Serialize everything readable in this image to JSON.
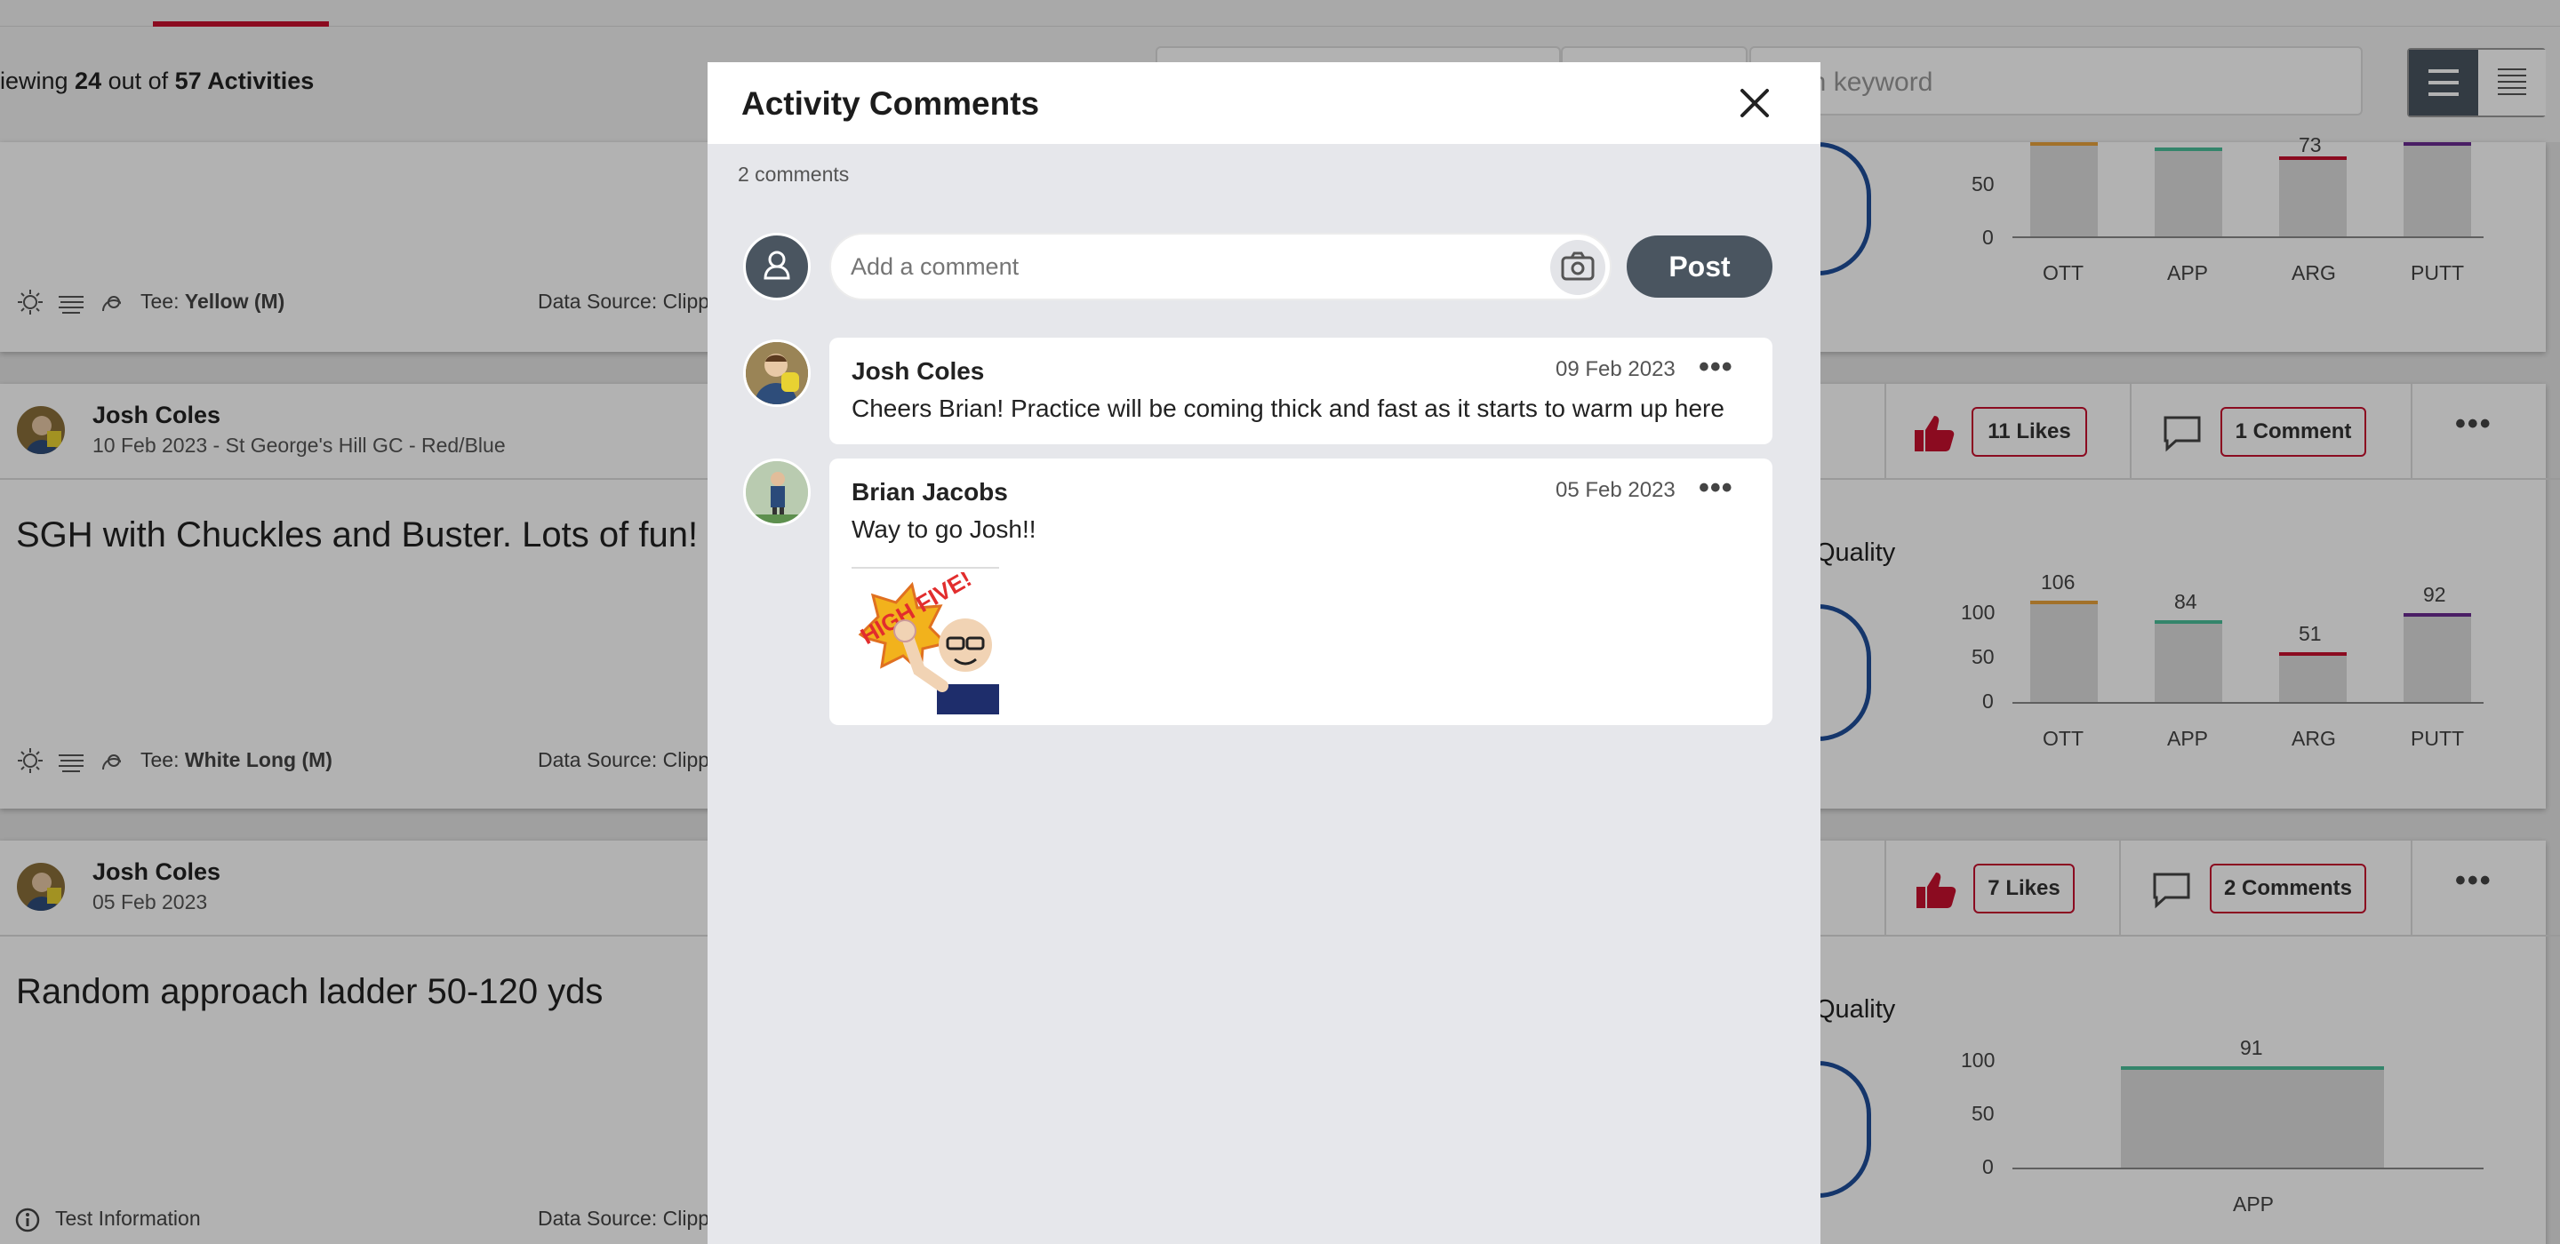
{
  "feed": {
    "viewing_prefix": "iewing ",
    "viewing_count": "24",
    "viewing_mid": " out of ",
    "viewing_total": "57 Activities",
    "search_placeholder": "arch keyword"
  },
  "activities": [
    {
      "tee_label": "Tee: ",
      "tee_value": "Yellow (M)",
      "data_source": "Data Source: Clipp",
      "chart_ticks": [
        "50",
        "0"
      ],
      "chart_labels": [
        "OTT",
        "APP",
        "ARG",
        "PUTT"
      ],
      "value_arg": "73"
    },
    {
      "user": "Josh Coles",
      "subtitle": "10 Feb 2023 - St George's Hill GC - Red/Blue",
      "likes": "11 Likes",
      "comments": "1 Comment",
      "title": "SGH with Chuckles and Buster. Lots of fun!",
      "quality_label": "Quality",
      "tee_label": "Tee: ",
      "tee_value": "White Long (M)",
      "data_source": "Data Source: Clipp",
      "chart_ticks": [
        "100",
        "50",
        "0"
      ],
      "chart_labels": [
        "OTT",
        "APP",
        "ARG",
        "PUTT"
      ],
      "values": [
        "106",
        "84",
        "51",
        "92"
      ]
    },
    {
      "user": "Josh Coles",
      "subtitle": "05 Feb 2023",
      "likes": "7 Likes",
      "comments": "2 Comments",
      "title": "Random approach ladder 50-120 yds",
      "quality_label": "Quality",
      "info": "Test Information",
      "data_source": "Data Source: Clipp",
      "chart_ticks": [
        "100",
        "50",
        "0"
      ],
      "chart_labels": [
        "APP"
      ],
      "values": [
        "91"
      ]
    }
  ],
  "modal": {
    "title": "Activity Comments",
    "count": "2 comments",
    "input_placeholder": "Add a comment",
    "post_label": "Post",
    "comments": [
      {
        "name": "Josh Coles",
        "date": "09 Feb 2023",
        "text": "Cheers Brian! Practice will be coming thick and fast as it starts to warm up here"
      },
      {
        "name": "Brian Jacobs",
        "date": "05 Feb 2023",
        "text": "Way to go Josh!!",
        "sticker_text": "HIGH FIVE!"
      }
    ]
  },
  "colors": {
    "accent_red": "#c8102e",
    "ott": "#e8a33d",
    "app": "#4bbf9a",
    "arg": "#c8102e",
    "putt": "#6a2c91",
    "button_dark": "#4a5560"
  }
}
